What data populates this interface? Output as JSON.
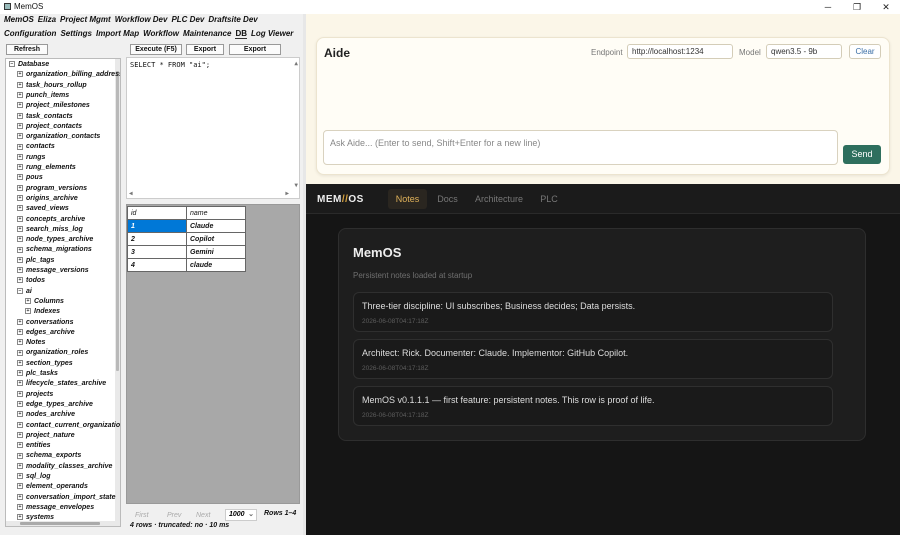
{
  "window": {
    "title": "MemOS",
    "min": "─",
    "max": "❐",
    "close": "✕"
  },
  "menu_top": [
    "MemOS",
    "Eliza",
    "Project Mgmt",
    "Workflow Dev",
    "PLC Dev",
    "Draftsite Dev"
  ],
  "menu_sub": [
    "Configuration",
    "Settings",
    "Import Map",
    "Workflow",
    "Maintenance",
    "DB",
    "Log Viewer"
  ],
  "toolbar": {
    "refresh": "Refresh",
    "execute": "Execute (F5)",
    "export1": "Export",
    "export2": "Export"
  },
  "tree": {
    "root": "Database",
    "items": [
      "organization_billing_address",
      "task_hours_rollup",
      "punch_items",
      "project_milestones",
      "task_contacts",
      "project_contacts",
      "organization_contacts",
      "contacts",
      "rungs",
      "rung_elements",
      "pous",
      "program_versions",
      "origins_archive",
      "saved_views",
      "concepts_archive",
      "search_miss_log",
      "node_types_archive",
      "schema_migrations",
      "plc_tags",
      "message_versions",
      "todos",
      "ai"
    ],
    "ai_children": [
      "Columns",
      "Indexes"
    ],
    "items_after": [
      "conversations",
      "edges_archive",
      "Notes",
      "organization_roles",
      "section_types",
      "plc_tasks",
      "lifecycle_states_archive",
      "projects",
      "edge_types_archive",
      "nodes_archive",
      "contact_current_organization",
      "project_nature",
      "entities",
      "schema_exports",
      "modality_classes_archive",
      "sql_log",
      "element_operands",
      "conversation_import_state",
      "message_envelopes",
      "systems"
    ]
  },
  "editor": {
    "sql": "SELECT * FROM \"ai\";"
  },
  "grid": {
    "columns": [
      "id",
      "name"
    ],
    "rows": [
      [
        "1",
        "Claude"
      ],
      [
        "2",
        "Copilot"
      ],
      [
        "3",
        "Gemini"
      ],
      [
        "4",
        "claude"
      ]
    ]
  },
  "pager": {
    "first": "First",
    "prev": "Prev",
    "next": "Next",
    "page_size": "1000",
    "rows_range": "Rows 1–4",
    "status": "4 rows · truncated: no · 10 ms"
  },
  "aide": {
    "title": "Aide",
    "endpoint_label": "Endpoint",
    "endpoint_value": "http://localhost:1234",
    "model_label": "Model",
    "model_value": "qwen3.5 - 9b",
    "clear": "Clear",
    "ask_placeholder": "Ask Aide...  (Enter to send, Shift+Enter for a new line)",
    "send": "Send"
  },
  "memos": {
    "logo_left": "MEM",
    "logo_slash": "//",
    "logo_right": "OS",
    "tabs": [
      "Notes",
      "Docs",
      "Architecture",
      "PLC"
    ],
    "active_tab": "Notes",
    "title": "MemOS",
    "subtitle": "Persistent notes loaded at startup",
    "notes": [
      {
        "text": "Three-tier discipline: UI subscribes; Business decides; Data persists.",
        "ts": "2026-06-08T04:17:18Z"
      },
      {
        "text": "Architect: Rick. Documenter: Claude. Implementor: GitHub Copilot.",
        "ts": "2026-06-08T04:17:18Z"
      },
      {
        "text": "MemOS v0.1.1.1 — first feature: persistent notes. This row is proof of life.",
        "ts": "2026-06-08T04:17:18Z"
      }
    ]
  },
  "colors": {
    "accent_dark": "#d9a441",
    "send_bg": "#2e6f5e",
    "selection": "#0078d7"
  }
}
